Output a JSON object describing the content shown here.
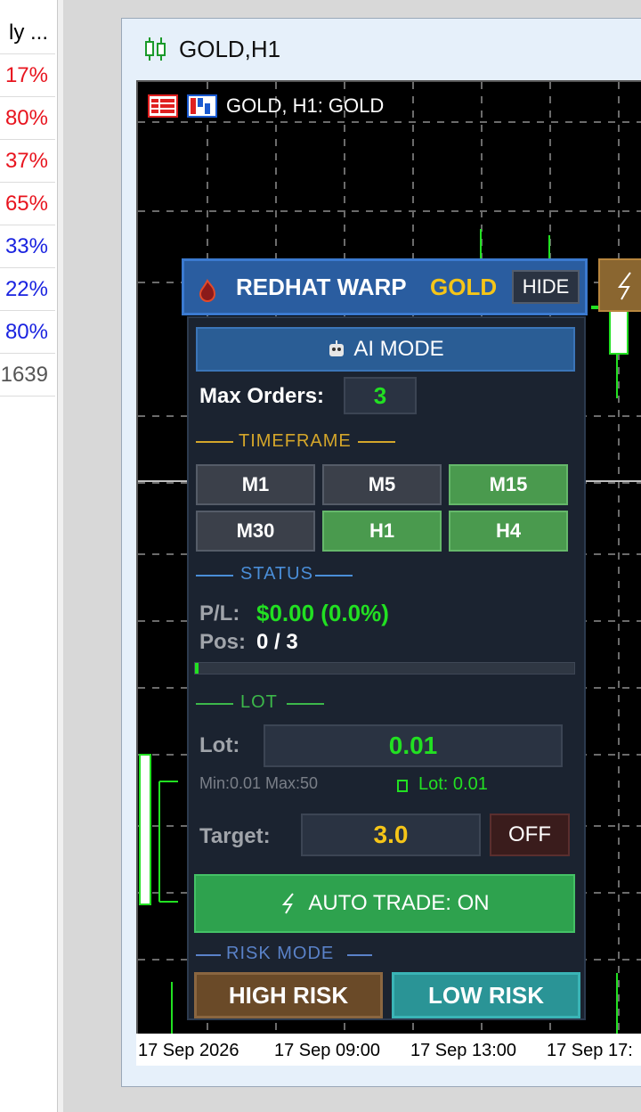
{
  "watchlist": {
    "rows": [
      {
        "text": "ly ...",
        "color": "#000000"
      },
      {
        "text": "17%",
        "color": "#e8141e"
      },
      {
        "text": "80%",
        "color": "#e8141e"
      },
      {
        "text": "37%",
        "color": "#e8141e"
      },
      {
        "text": "65%",
        "color": "#e8141e"
      },
      {
        "text": "33%",
        "color": "#1a23e0"
      },
      {
        "text": "22%",
        "color": "#1a23e0"
      },
      {
        "text": "80%",
        "color": "#1a23e0"
      },
      {
        "text": "1639",
        "color": "#555555"
      }
    ]
  },
  "window": {
    "title": "GOLD,H1",
    "chart_label": "GOLD, H1:  GOLD"
  },
  "time_axis": [
    "17 Sep 2026",
    "17 Sep 09:00",
    "17 Sep 13:00",
    "17 Sep 17:"
  ],
  "panel": {
    "title": "REDHAT WARP",
    "symbol": "GOLD",
    "hide_label": "HIDE",
    "ai_mode_label": "AI MODE",
    "max_orders_label": "Max Orders:",
    "max_orders_value": "3",
    "timeframe_label": "TIMEFRAME",
    "timeframes": [
      {
        "label": "M1",
        "active": false
      },
      {
        "label": "M5",
        "active": false
      },
      {
        "label": "M15",
        "active": true
      },
      {
        "label": "M30",
        "active": false
      },
      {
        "label": "H1",
        "active": true
      },
      {
        "label": "H4",
        "active": true
      }
    ],
    "status_label": "STATUS",
    "pl_label": "P/L:",
    "pl_value": "$0.00 (0.0%)",
    "pos_label": "Pos:",
    "pos_value": "0 / 3",
    "lot_section_label": "LOT",
    "lot_label": "Lot:",
    "lot_value": "0.01",
    "lot_min_max": "Min:0.01  Max:50",
    "lot_current": "Lot: 0.01",
    "target_label": "Target:",
    "target_value": "3.0",
    "target_toggle": "OFF",
    "auto_trade_label": "AUTO TRADE: ON",
    "risk_mode_label": "RISK MODE",
    "high_risk_label": "HIGH RISK",
    "low_risk_label": "LOW RISK"
  },
  "colors": {
    "green": "#22e022",
    "gold": "#f5c518",
    "header_blue": "#2a5da0"
  }
}
